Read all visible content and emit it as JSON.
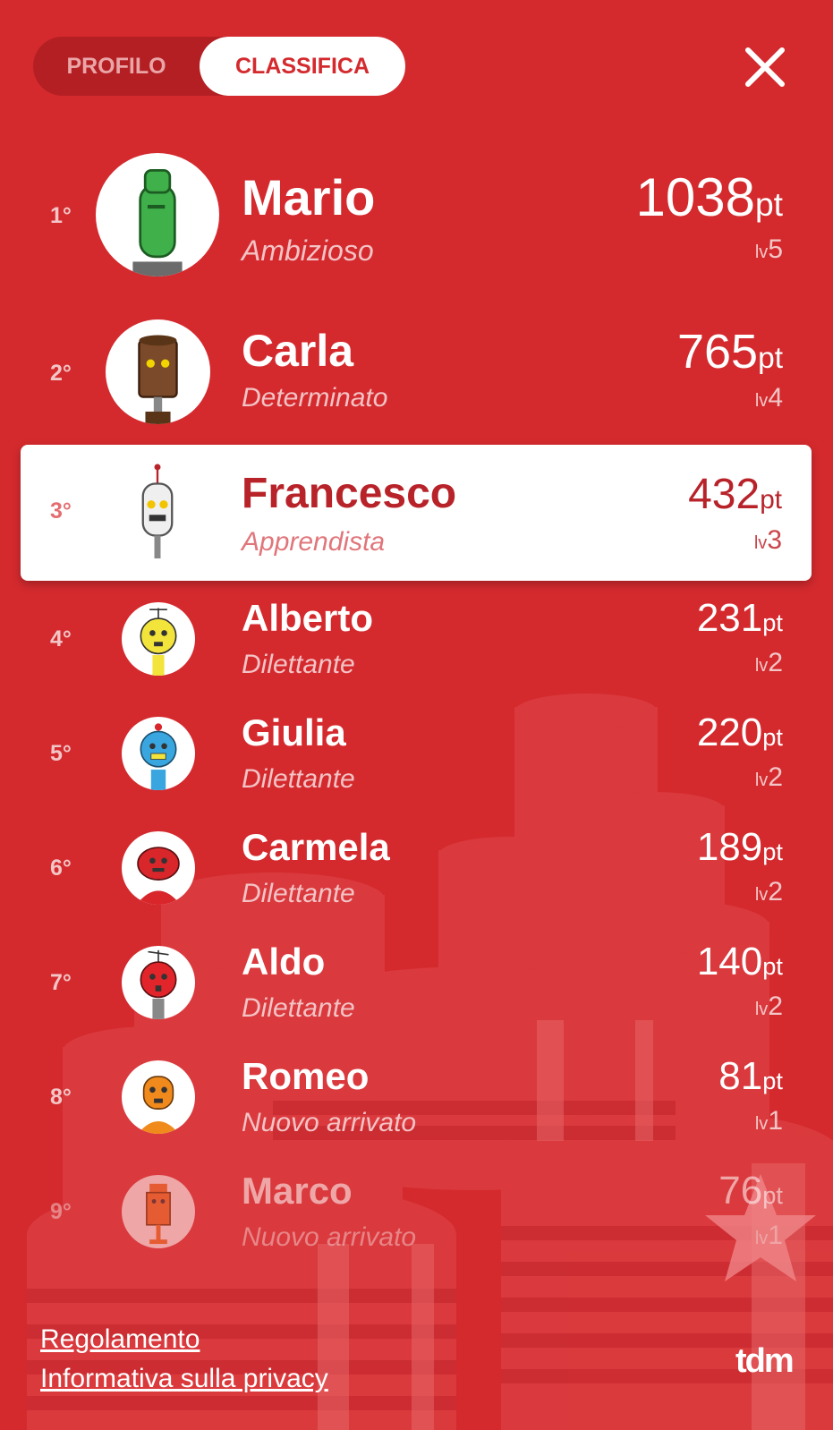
{
  "tabs": {
    "profile": "PROFILO",
    "leaderboard": "CLASSIFICA"
  },
  "leaderboard": [
    {
      "rank": "1°",
      "name": "Mario",
      "title": "Ambizioso",
      "points": "1038",
      "pt_unit": "pt",
      "lv_prefix": "lv",
      "level": "5",
      "avatar": "green-robot-avatar",
      "color": "#3fb04a"
    },
    {
      "rank": "2°",
      "name": "Carla",
      "title": "Determinato",
      "points": "765",
      "pt_unit": "pt",
      "lv_prefix": "lv",
      "level": "4",
      "avatar": "brown-robot-avatar",
      "color": "#7a4a2a"
    },
    {
      "rank": "3°",
      "name": "Francesco",
      "title": "Apprendista",
      "points": "432",
      "pt_unit": "pt",
      "lv_prefix": "lv",
      "level": "3",
      "avatar": "white-robot-avatar",
      "color": "#e8e8e8"
    },
    {
      "rank": "4°",
      "name": "Alberto",
      "title": "Dilettante",
      "points": "231",
      "pt_unit": "pt",
      "lv_prefix": "lv",
      "level": "2",
      "avatar": "yellow-robot-avatar",
      "color": "#f2e43a"
    },
    {
      "rank": "5°",
      "name": "Giulia",
      "title": "Dilettante",
      "points": "220",
      "pt_unit": "pt",
      "lv_prefix": "lv",
      "level": "2",
      "avatar": "blue-robot-avatar",
      "color": "#3aa6e0"
    },
    {
      "rank": "6°",
      "name": "Carmela",
      "title": "Dilettante",
      "points": "189",
      "pt_unit": "pt",
      "lv_prefix": "lv",
      "level": "2",
      "avatar": "red-robot-avatar",
      "color": "#d8262b"
    },
    {
      "rank": "7°",
      "name": "Aldo",
      "title": "Dilettante",
      "points": "140",
      "pt_unit": "pt",
      "lv_prefix": "lv",
      "level": "2",
      "avatar": "red-antenna-robot-avatar",
      "color": "#e1252b"
    },
    {
      "rank": "8°",
      "name": "Romeo",
      "title": "Nuovo arrivato",
      "points": "81",
      "pt_unit": "pt",
      "lv_prefix": "lv",
      "level": "1",
      "avatar": "orange-robot-avatar",
      "color": "#f08a1c"
    },
    {
      "rank": "9°",
      "name": "Marco",
      "title": "Nuovo arrivato",
      "points": "76",
      "pt_unit": "pt",
      "lv_prefix": "lv",
      "level": "1",
      "avatar": "orange-box-robot-avatar",
      "color": "#ee7a2a"
    }
  ],
  "footer": {
    "rules": "Regolamento",
    "privacy": "Informativa sulla privacy",
    "brand": "tdm"
  },
  "colors": {
    "background": "#d42a2e",
    "highlight_text": "#b8232a",
    "tab_track": "#b41f24"
  }
}
